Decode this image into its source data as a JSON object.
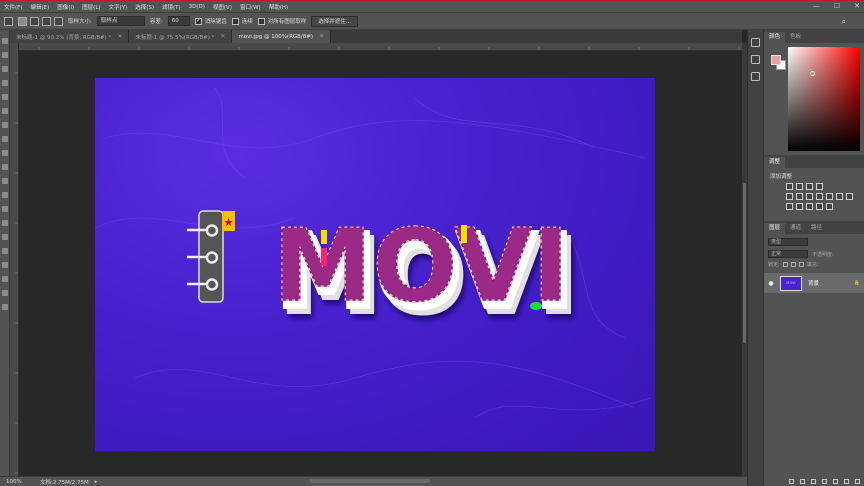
{
  "menu": {
    "items": [
      "文件(F)",
      "编辑(E)",
      "图像(I)",
      "图层(L)",
      "文字(Y)",
      "选择(S)",
      "滤镜(T)",
      "3D(D)",
      "视图(V)",
      "窗口(W)",
      "帮助(H)"
    ],
    "window_controls": [
      "—",
      "☐",
      "✕"
    ]
  },
  "options": {
    "sample_size_label": "取样大小:",
    "sample_size_value": "取样点",
    "tolerance_label": "容差:",
    "tolerance_value": "60",
    "anti_alias_label": "消除锯齿",
    "contiguous_label": "连续",
    "sample_all_label": "对所有图层取样",
    "select_subject_label": "选择并遮住..."
  },
  "tabs": [
    {
      "label": "未标题-1 @ 90.2% (背景, RGB/8#) *",
      "close": "✕"
    },
    {
      "label": "未标题-1 @ 75.5%(RGB/8#) *",
      "close": "✕"
    },
    {
      "label": "movi.jpg @ 100%(RGB/8#)",
      "close": "✕"
    }
  ],
  "canvas_text": {
    "letters": "MOVI"
  },
  "status": {
    "zoom": "100%",
    "doc": "文档:2.75M/2.75M",
    "arrow": "▸"
  },
  "panels": {
    "color_tabs": [
      "颜色",
      "色板"
    ],
    "adjust_tabs": [
      "调整"
    ],
    "adjust_title": "添加调整",
    "layers_tabs": [
      "图层",
      "通道",
      "路径"
    ],
    "layer_kind": "类型",
    "blend_mode": "正常",
    "opacity_label": "不透明度:",
    "lock_label": "锁定:",
    "fill_label": "填充:",
    "layer": {
      "eye": "●",
      "name": "背景",
      "thumb_text": "MOVI",
      "lock": "🔒"
    }
  },
  "colors": {
    "canvas": "#4a22d0",
    "foreground": "#e8a0a8",
    "background": "#ffffff",
    "letter_fill": "#9b2a86",
    "stitch": "#ffd7f0"
  }
}
